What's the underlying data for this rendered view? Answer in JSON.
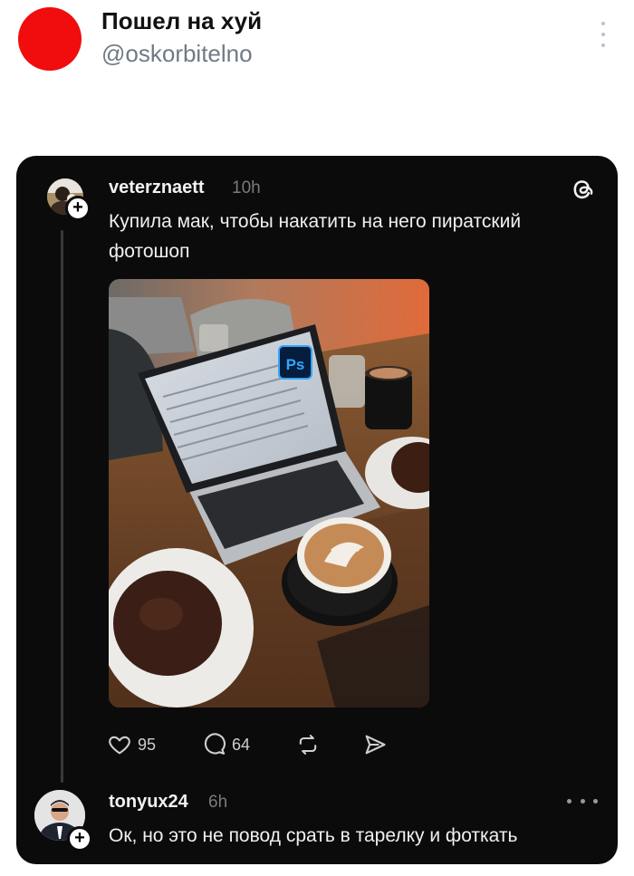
{
  "header": {
    "name": "Пошел на хуй",
    "handle": "@oskorbitelno",
    "avatar_color": "#f10d0d",
    "menu_icon": "kebab-vertical-icon"
  },
  "post": {
    "username": "veterznaett",
    "time": "10h",
    "text": "Купила мак, чтобы накатить на него пиратский фотошоп",
    "photo_badge": "Ps",
    "likes": "95",
    "comments": "64",
    "icons": [
      "heart-icon",
      "comment-icon",
      "repost-icon",
      "share-icon",
      "threads-logo-icon"
    ]
  },
  "reply": {
    "username": "tonyux24",
    "time": "6h",
    "text": "Ок, но это не повод срать в тарелку и фоткать"
  },
  "colors": {
    "card_bg": "#0b0b0b",
    "muted": "#7b7b7b",
    "handle": "#6f7a85"
  }
}
